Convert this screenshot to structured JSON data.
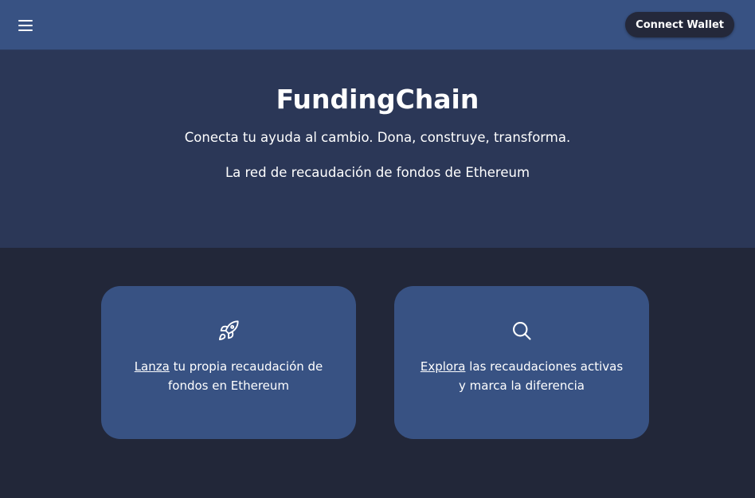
{
  "header": {
    "menu_icon": "hamburger-menu-icon",
    "connect_label": "Connect Wallet"
  },
  "hero": {
    "title": "FundingChain",
    "subtitle": "Conecta tu ayuda al cambio. Dona, construye, transforma.",
    "tagline": "La red de recaudación de fondos de Ethereum"
  },
  "cards": [
    {
      "icon": "rocket-icon",
      "link": "Lanza",
      "text_line1": " tu propia recaudación de",
      "text_line2": "fondos en Ethereum"
    },
    {
      "icon": "search-icon",
      "link": "Explora",
      "text_line1": " las recaudaciones activas",
      "text_line2": "y marca la diferencia"
    }
  ],
  "colors": {
    "header_bg": "#385283",
    "hero_bg": "#2b3757",
    "body_bg": "#222739",
    "card_bg": "#385283",
    "button_bg": "#24283a",
    "text": "#ffffff"
  }
}
